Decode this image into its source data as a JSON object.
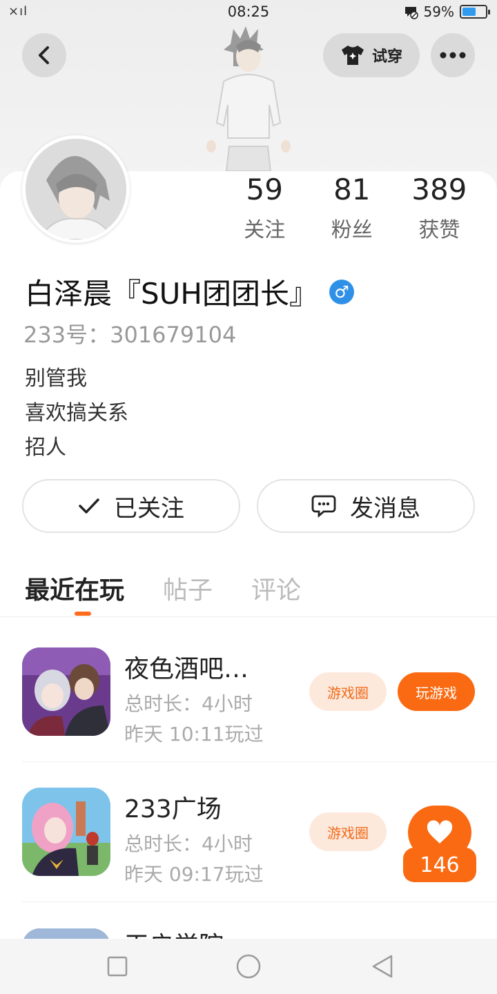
{
  "status_bar": {
    "signal": "×ıl",
    "time": "08:25",
    "battery_percent": "59%",
    "battery_level": 0.59
  },
  "header": {
    "try_on_label": "试穿"
  },
  "profile": {
    "stats": [
      {
        "num": "59",
        "label": "关注"
      },
      {
        "num": "81",
        "label": "粉丝"
      },
      {
        "num": "389",
        "label": "获赞"
      }
    ],
    "nickname": "白泽晨『SUH团团长』",
    "gender_symbol": "♂",
    "uid": "233号：301679104",
    "bio_lines": [
      "别管我",
      "喜欢搞关系",
      "招人"
    ]
  },
  "actions": {
    "follow_label": "已关注",
    "message_label": "发消息"
  },
  "tabs": [
    "最近在玩",
    "帖子",
    "评论"
  ],
  "games": [
    {
      "title": "夜色酒吧…",
      "duration": "总时长：4小时",
      "last_played": "昨天 10:11玩过",
      "circle_label": "游戏圈",
      "play_label": "玩游戏"
    },
    {
      "title": "233广场",
      "duration": "总时长：4小时",
      "last_played": "昨天 09:17玩过",
      "circle_label": "游戏圈"
    },
    {
      "title": "天启学院…"
    }
  ],
  "floating_like": {
    "count": "146"
  },
  "colors": {
    "accent": "#fa6a12",
    "accent_light": "#fde9dc",
    "male_blue": "#2f90e8"
  }
}
